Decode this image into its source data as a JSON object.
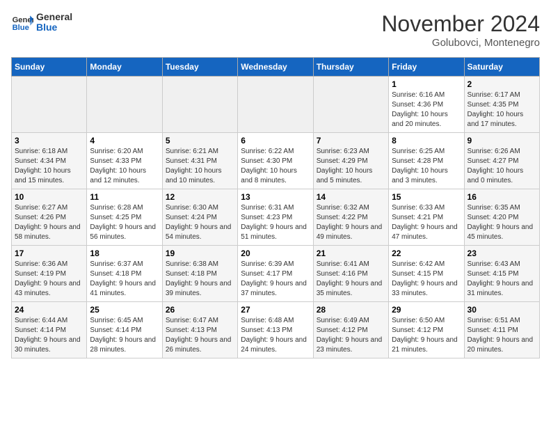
{
  "header": {
    "logo_line1": "General",
    "logo_line2": "Blue",
    "month_title": "November 2024",
    "location": "Golubovci, Montenegro"
  },
  "days_of_week": [
    "Sunday",
    "Monday",
    "Tuesday",
    "Wednesday",
    "Thursday",
    "Friday",
    "Saturday"
  ],
  "weeks": [
    [
      {
        "day": "",
        "info": ""
      },
      {
        "day": "",
        "info": ""
      },
      {
        "day": "",
        "info": ""
      },
      {
        "day": "",
        "info": ""
      },
      {
        "day": "",
        "info": ""
      },
      {
        "day": "1",
        "info": "Sunrise: 6:16 AM\nSunset: 4:36 PM\nDaylight: 10 hours and 20 minutes."
      },
      {
        "day": "2",
        "info": "Sunrise: 6:17 AM\nSunset: 4:35 PM\nDaylight: 10 hours and 17 minutes."
      }
    ],
    [
      {
        "day": "3",
        "info": "Sunrise: 6:18 AM\nSunset: 4:34 PM\nDaylight: 10 hours and 15 minutes."
      },
      {
        "day": "4",
        "info": "Sunrise: 6:20 AM\nSunset: 4:33 PM\nDaylight: 10 hours and 12 minutes."
      },
      {
        "day": "5",
        "info": "Sunrise: 6:21 AM\nSunset: 4:31 PM\nDaylight: 10 hours and 10 minutes."
      },
      {
        "day": "6",
        "info": "Sunrise: 6:22 AM\nSunset: 4:30 PM\nDaylight: 10 hours and 8 minutes."
      },
      {
        "day": "7",
        "info": "Sunrise: 6:23 AM\nSunset: 4:29 PM\nDaylight: 10 hours and 5 minutes."
      },
      {
        "day": "8",
        "info": "Sunrise: 6:25 AM\nSunset: 4:28 PM\nDaylight: 10 hours and 3 minutes."
      },
      {
        "day": "9",
        "info": "Sunrise: 6:26 AM\nSunset: 4:27 PM\nDaylight: 10 hours and 0 minutes."
      }
    ],
    [
      {
        "day": "10",
        "info": "Sunrise: 6:27 AM\nSunset: 4:26 PM\nDaylight: 9 hours and 58 minutes."
      },
      {
        "day": "11",
        "info": "Sunrise: 6:28 AM\nSunset: 4:25 PM\nDaylight: 9 hours and 56 minutes."
      },
      {
        "day": "12",
        "info": "Sunrise: 6:30 AM\nSunset: 4:24 PM\nDaylight: 9 hours and 54 minutes."
      },
      {
        "day": "13",
        "info": "Sunrise: 6:31 AM\nSunset: 4:23 PM\nDaylight: 9 hours and 51 minutes."
      },
      {
        "day": "14",
        "info": "Sunrise: 6:32 AM\nSunset: 4:22 PM\nDaylight: 9 hours and 49 minutes."
      },
      {
        "day": "15",
        "info": "Sunrise: 6:33 AM\nSunset: 4:21 PM\nDaylight: 9 hours and 47 minutes."
      },
      {
        "day": "16",
        "info": "Sunrise: 6:35 AM\nSunset: 4:20 PM\nDaylight: 9 hours and 45 minutes."
      }
    ],
    [
      {
        "day": "17",
        "info": "Sunrise: 6:36 AM\nSunset: 4:19 PM\nDaylight: 9 hours and 43 minutes."
      },
      {
        "day": "18",
        "info": "Sunrise: 6:37 AM\nSunset: 4:18 PM\nDaylight: 9 hours and 41 minutes."
      },
      {
        "day": "19",
        "info": "Sunrise: 6:38 AM\nSunset: 4:18 PM\nDaylight: 9 hours and 39 minutes."
      },
      {
        "day": "20",
        "info": "Sunrise: 6:39 AM\nSunset: 4:17 PM\nDaylight: 9 hours and 37 minutes."
      },
      {
        "day": "21",
        "info": "Sunrise: 6:41 AM\nSunset: 4:16 PM\nDaylight: 9 hours and 35 minutes."
      },
      {
        "day": "22",
        "info": "Sunrise: 6:42 AM\nSunset: 4:15 PM\nDaylight: 9 hours and 33 minutes."
      },
      {
        "day": "23",
        "info": "Sunrise: 6:43 AM\nSunset: 4:15 PM\nDaylight: 9 hours and 31 minutes."
      }
    ],
    [
      {
        "day": "24",
        "info": "Sunrise: 6:44 AM\nSunset: 4:14 PM\nDaylight: 9 hours and 30 minutes."
      },
      {
        "day": "25",
        "info": "Sunrise: 6:45 AM\nSunset: 4:14 PM\nDaylight: 9 hours and 28 minutes."
      },
      {
        "day": "26",
        "info": "Sunrise: 6:47 AM\nSunset: 4:13 PM\nDaylight: 9 hours and 26 minutes."
      },
      {
        "day": "27",
        "info": "Sunrise: 6:48 AM\nSunset: 4:13 PM\nDaylight: 9 hours and 24 minutes."
      },
      {
        "day": "28",
        "info": "Sunrise: 6:49 AM\nSunset: 4:12 PM\nDaylight: 9 hours and 23 minutes."
      },
      {
        "day": "29",
        "info": "Sunrise: 6:50 AM\nSunset: 4:12 PM\nDaylight: 9 hours and 21 minutes."
      },
      {
        "day": "30",
        "info": "Sunrise: 6:51 AM\nSunset: 4:11 PM\nDaylight: 9 hours and 20 minutes."
      }
    ]
  ]
}
